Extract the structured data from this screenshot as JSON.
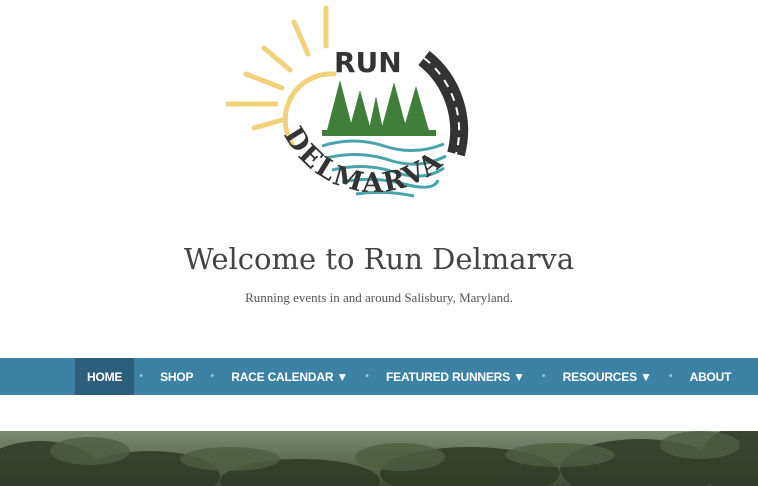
{
  "site": {
    "title": "Welcome to Run Delmarva",
    "tagline": "Running events in and around Salisbury, Maryland."
  },
  "logo": {
    "word_top": "RUN",
    "word_bottom": "DELMARVA",
    "colors": {
      "sun": "#f0d27a",
      "trees": "#3f7f3a",
      "water": "#4aa3a8",
      "text": "#333333"
    }
  },
  "nav": {
    "items": [
      {
        "label": "HOME"
      },
      {
        "label": "SHOP"
      },
      {
        "label": "RACE CALENDAR ▼"
      },
      {
        "label": "FEATURED RUNNERS ▼"
      },
      {
        "label": "RESOURCES ▼"
      },
      {
        "label": "ABOUT"
      }
    ],
    "separator": "•",
    "colors": {
      "bar": "#3d82a4",
      "active": "#2b5f7b"
    }
  }
}
